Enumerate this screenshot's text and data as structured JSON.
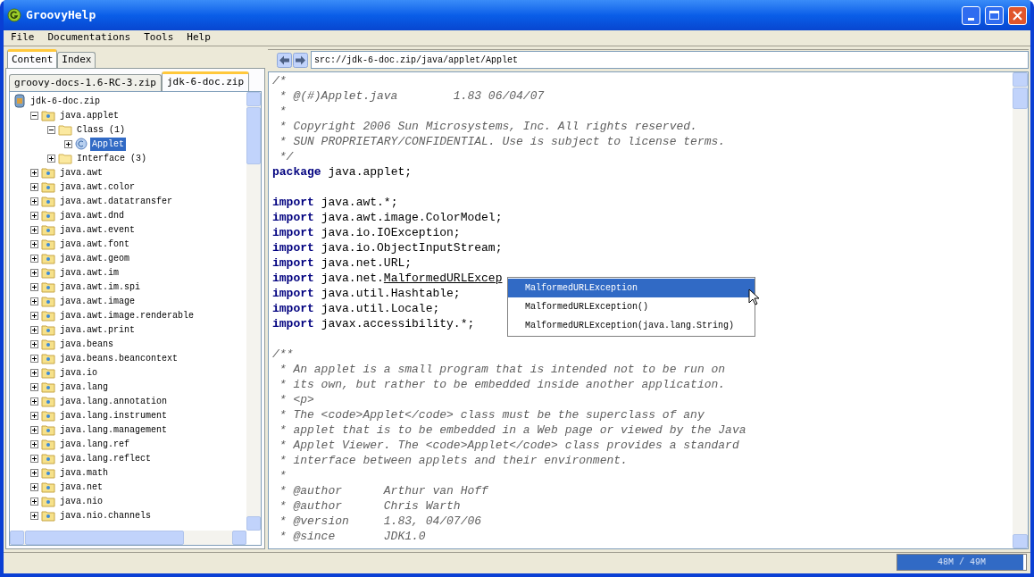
{
  "window": {
    "title": "GroovyHelp"
  },
  "menu": [
    "File",
    "Documentations",
    "Tools",
    "Help"
  ],
  "left_tabs": [
    {
      "label": "Content",
      "selected": true
    },
    {
      "label": "Index",
      "selected": false
    }
  ],
  "doc_tabs": [
    {
      "label": "groovy-docs-1.6-RC-3.zip",
      "selected": false
    },
    {
      "label": "jdk-6-doc.zip",
      "selected": true
    }
  ],
  "tree": {
    "label": "jdk-6-doc.zip",
    "kind": "archive",
    "children": [
      {
        "label": "java.applet",
        "kind": "package",
        "expanded": true,
        "selected": false,
        "children": [
          {
            "label": "Class (1)",
            "kind": "folder",
            "expanded": true,
            "selected": false,
            "children": [
              {
                "label": "Applet",
                "kind": "class",
                "expanded": false,
                "selected": true
              }
            ]
          },
          {
            "label": "Interface (3)",
            "kind": "folder",
            "expanded": false,
            "selected": false
          }
        ]
      },
      {
        "label": "java.awt",
        "kind": "package",
        "expanded": false,
        "selected": false
      },
      {
        "label": "java.awt.color",
        "kind": "package",
        "expanded": false,
        "selected": false
      },
      {
        "label": "java.awt.datatransfer",
        "kind": "package",
        "expanded": false,
        "selected": false
      },
      {
        "label": "java.awt.dnd",
        "kind": "package",
        "expanded": false,
        "selected": false
      },
      {
        "label": "java.awt.event",
        "kind": "package",
        "expanded": false,
        "selected": false
      },
      {
        "label": "java.awt.font",
        "kind": "package",
        "expanded": false,
        "selected": false
      },
      {
        "label": "java.awt.geom",
        "kind": "package",
        "expanded": false,
        "selected": false
      },
      {
        "label": "java.awt.im",
        "kind": "package",
        "expanded": false,
        "selected": false
      },
      {
        "label": "java.awt.im.spi",
        "kind": "package",
        "expanded": false,
        "selected": false
      },
      {
        "label": "java.awt.image",
        "kind": "package",
        "expanded": false,
        "selected": false
      },
      {
        "label": "java.awt.image.renderable",
        "kind": "package",
        "expanded": false,
        "selected": false
      },
      {
        "label": "java.awt.print",
        "kind": "package",
        "expanded": false,
        "selected": false
      },
      {
        "label": "java.beans",
        "kind": "package",
        "expanded": false,
        "selected": false
      },
      {
        "label": "java.beans.beancontext",
        "kind": "package",
        "expanded": false,
        "selected": false
      },
      {
        "label": "java.io",
        "kind": "package",
        "expanded": false,
        "selected": false
      },
      {
        "label": "java.lang",
        "kind": "package",
        "expanded": false,
        "selected": false
      },
      {
        "label": "java.lang.annotation",
        "kind": "package",
        "expanded": false,
        "selected": false
      },
      {
        "label": "java.lang.instrument",
        "kind": "package",
        "expanded": false,
        "selected": false
      },
      {
        "label": "java.lang.management",
        "kind": "package",
        "expanded": false,
        "selected": false
      },
      {
        "label": "java.lang.ref",
        "kind": "package",
        "expanded": false,
        "selected": false
      },
      {
        "label": "java.lang.reflect",
        "kind": "package",
        "expanded": false,
        "selected": false
      },
      {
        "label": "java.math",
        "kind": "package",
        "expanded": false,
        "selected": false
      },
      {
        "label": "java.net",
        "kind": "package",
        "expanded": false,
        "selected": false
      },
      {
        "label": "java.nio",
        "kind": "package",
        "expanded": false,
        "selected": false
      },
      {
        "label": "java.nio.channels",
        "kind": "package",
        "expanded": false,
        "selected": false
      }
    ]
  },
  "address": {
    "value": "src://jdk-6-doc.zip/java/applet/Applet"
  },
  "code": [
    {
      "kind": "comment",
      "text": "/*"
    },
    {
      "kind": "comment",
      "text": " * @(#)Applet.java        1.83 06/04/07"
    },
    {
      "kind": "comment",
      "text": " *"
    },
    {
      "kind": "comment",
      "text": " * Copyright 2006 Sun Microsystems, Inc. All rights reserved."
    },
    {
      "kind": "comment",
      "text": " * SUN PROPRIETARY/CONFIDENTIAL. Use is subject to license terms."
    },
    {
      "kind": "comment",
      "text": " */"
    },
    {
      "kind": "code",
      "keyword": "package",
      "text": "java.applet;"
    },
    {
      "kind": "blank"
    },
    {
      "kind": "code",
      "keyword": "import",
      "text": "java.awt.*;"
    },
    {
      "kind": "code",
      "keyword": "import",
      "text": "java.awt.image.ColorModel;"
    },
    {
      "kind": "code",
      "keyword": "import",
      "text": "java.io.IOException;"
    },
    {
      "kind": "code",
      "keyword": "import",
      "text": "java.io.ObjectInputStream;"
    },
    {
      "kind": "code",
      "keyword": "import",
      "text": "java.net.URL;"
    },
    {
      "kind": "code",
      "keyword": "import",
      "text": "java.net.",
      "link": "MalformedURLExcep"
    },
    {
      "kind": "code",
      "keyword": "import",
      "text": "java.util.Hashtable;"
    },
    {
      "kind": "code",
      "keyword": "import",
      "text": "java.util.Locale;"
    },
    {
      "kind": "code",
      "keyword": "import",
      "text": "javax.accessibility.*;"
    },
    {
      "kind": "blank"
    },
    {
      "kind": "comment",
      "text": "/**"
    },
    {
      "kind": "comment",
      "text": " * An applet is a small program that is intended not to be run on"
    },
    {
      "kind": "comment",
      "text": " * its own, but rather to be embedded inside another application."
    },
    {
      "kind": "comment",
      "text": " * <p>"
    },
    {
      "kind": "comment",
      "text": " * The <code>Applet</code> class must be the superclass of any"
    },
    {
      "kind": "comment",
      "text": " * applet that is to be embedded in a Web page or viewed by the Java"
    },
    {
      "kind": "comment",
      "text": " * Applet Viewer. The <code>Applet</code> class provides a standard"
    },
    {
      "kind": "comment",
      "text": " * interface between applets and their environment."
    },
    {
      "kind": "comment",
      "text": " *"
    },
    {
      "kind": "comment",
      "text": " * @author      Arthur van Hoff"
    },
    {
      "kind": "comment",
      "text": " * @author      Chris Warth"
    },
    {
      "kind": "comment",
      "text": " * @version     1.83, 04/07/06"
    },
    {
      "kind": "comment",
      "text": " * @since       JDK1.0"
    }
  ],
  "completion": [
    {
      "label": "MalformedURLException",
      "selected": true
    },
    {
      "label": "MalformedURLException()",
      "selected": false
    },
    {
      "label": "MalformedURLException(java.lang.String)",
      "selected": false
    }
  ],
  "status_bar": {
    "memory": {
      "reading": "48M / 49M",
      "level": 0.98
    }
  }
}
